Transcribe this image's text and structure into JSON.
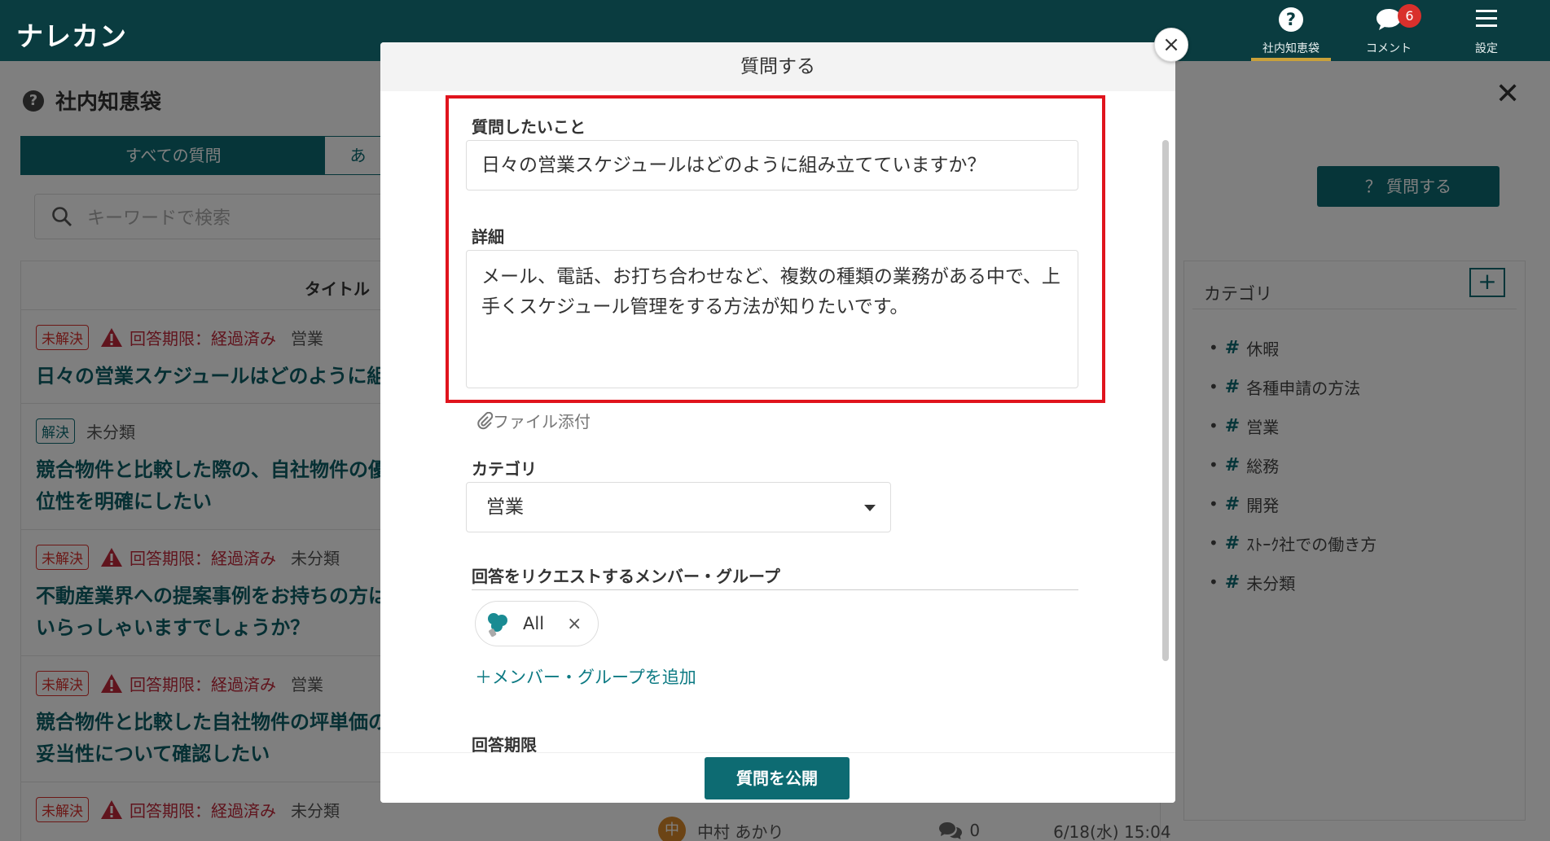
{
  "header": {
    "logo": "ナレカン",
    "nav": [
      {
        "label": "社内知恵袋",
        "icon": "question-circle-icon"
      },
      {
        "label": "コメント",
        "icon": "comment-bubble-icon",
        "badge": "6"
      },
      {
        "label": "設定",
        "icon": "hamburger-menu-icon"
      }
    ]
  },
  "page": {
    "title": "社内知恵袋",
    "tabs": {
      "all": "すべての質問",
      "other": "あ"
    },
    "search_placeholder": "キーワードで検索",
    "list_header": "タイトル",
    "ask_button": "？ 質問する",
    "rows": [
      {
        "status": "未解決",
        "limit": "回答期限：経過済み",
        "category": "営業",
        "title": "日々の営業スケジュールはどのように組"
      },
      {
        "status": "解決",
        "limit": "",
        "category": "未分類",
        "title": "競合物件と比較した際の、自社物件の優位性を明確にしたい"
      },
      {
        "status": "未解決",
        "limit": "回答期限：経過済み",
        "category": "未分類",
        "title": "不動産業界への提案事例をお持ちの方はいらっしゃいますでしょうか？"
      },
      {
        "status": "未解決",
        "limit": "回答期限：経過済み",
        "category": "営業",
        "title": "競合物件と比較した自社物件の坪単価の妥当性について確認したい"
      },
      {
        "status": "未解決",
        "limit": "回答期限：経過済み",
        "category": "未分類",
        "title": ""
      }
    ],
    "bottom_row": {
      "avatar": "中",
      "author": "中村 あかり",
      "comments": "0",
      "date": "6/18(水) 15:04"
    },
    "categories": {
      "title": "カテゴリ",
      "add": "+",
      "items": [
        "休暇",
        "各種申請の方法",
        "営業",
        "総務",
        "開発",
        "ｽﾄｰｸ社での働き方",
        "未分類"
      ]
    }
  },
  "modal": {
    "title": "質問する",
    "close": "×",
    "question_label": "質問したいこと",
    "question_value": "日々の営業スケジュールはどのように組み立てていますか？",
    "detail_label": "詳細",
    "detail_value": "メール、電話、お打ち合わせなど、複数の種類の業務がある中で、上手くスケジュール管理をする方法が知りたいです。",
    "attach_label": "ファイル添付",
    "category_label": "カテゴリ",
    "category_value": "営業",
    "request_label": "回答をリクエストするメンバー・グループ",
    "chip_label": "All",
    "chip_remove": "×",
    "add_member": "＋メンバー・グループを追加",
    "deadline_label": "回答期限",
    "publish": "質問を公開"
  },
  "colors": {
    "header": "#0a3c40",
    "accent": "#0d6b72",
    "highlight": "#e0141d",
    "danger": "#d9302c"
  }
}
